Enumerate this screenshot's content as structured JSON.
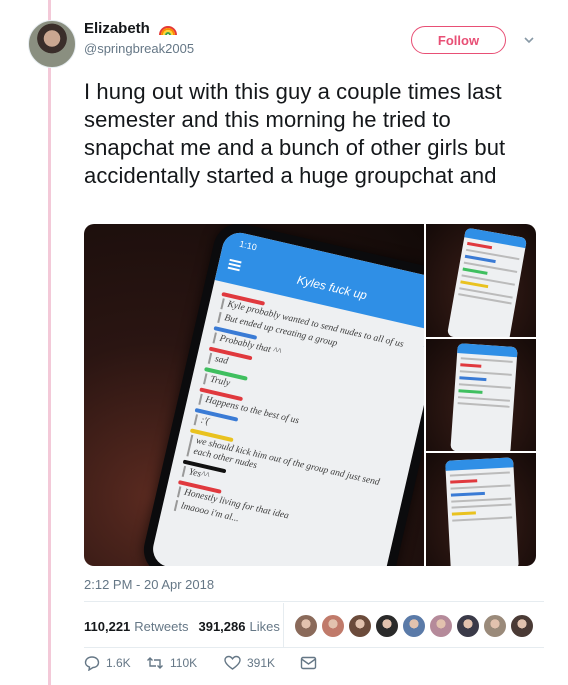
{
  "user": {
    "display_name": "Elizabeth",
    "handle": "@springbreak2005",
    "name_emoji": "rainbow-icon"
  },
  "header": {
    "follow_label": "Follow"
  },
  "tweet": {
    "text": "I hung out with this guy a couple times last semester and this morning he tried to snapchat me and a bunch of other girls but accidentally started a huge groupchat and",
    "timestamp": "2:12 PM - 20 Apr 2018"
  },
  "media": {
    "screen_time": "1:10",
    "chat_title": "Kyles fuck up",
    "messages": [
      {
        "text": "Kyle probably wanted to send nudes to all of us",
        "bar": "#e0393e"
      },
      {
        "text": "But ended up creating a group",
        "bar": ""
      },
      {
        "text": "Probably that ^^",
        "bar": "#3a7bd5"
      },
      {
        "text": "sad",
        "bar": "#e0393e"
      },
      {
        "text": "Truly",
        "bar": "#3fbf5f"
      },
      {
        "text": "Happens to the best of us",
        "bar": "#e0393e"
      },
      {
        "text": ":'(",
        "bar": "#3a7bd5"
      },
      {
        "text": "we should kick him out of the group and just send each other nudes",
        "bar": "#e9c21f"
      },
      {
        "text": "Yes^^",
        "bar": "#111111"
      },
      {
        "text": "Honestly living for that idea",
        "bar": "#e0393e"
      },
      {
        "text": "lmaooo i'm al...",
        "bar": ""
      }
    ]
  },
  "stats": {
    "retweets": "110,221",
    "retweets_label": "Retweets",
    "likes": "391,286",
    "likes_label": "Likes",
    "liker_colors": [
      "#8a6a5a",
      "#c07a6a",
      "#6b4b3b",
      "#2a2a2a",
      "#5a7aa8",
      "#b58a9a",
      "#3a3a48",
      "#9a8a7a",
      "#4a3a35"
    ]
  },
  "actions": {
    "reply_count": "1.6K",
    "retweet_count": "110K",
    "like_count": "391K"
  },
  "colors": {
    "accent": "#e84f75",
    "thread_line": "#f3c9d8",
    "muted": "#657786"
  }
}
